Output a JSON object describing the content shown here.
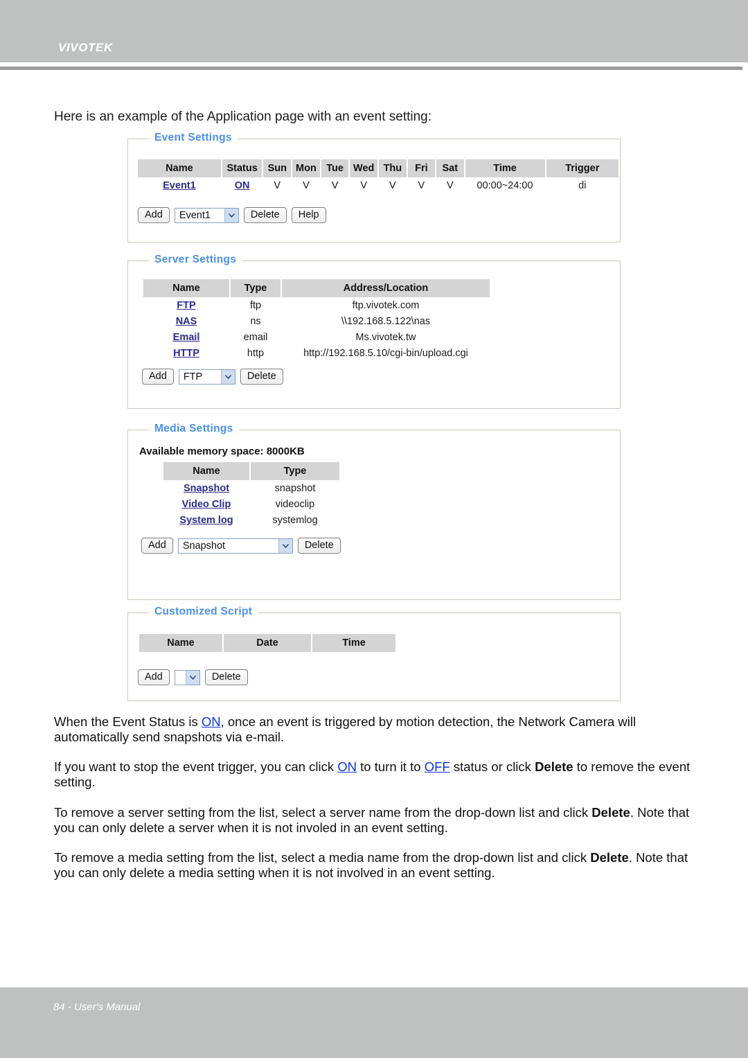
{
  "header": {
    "brand": "VIVOTEK"
  },
  "footer": {
    "text": "84 - User's Manual"
  },
  "intro": "Here is an example of the Application page with an event setting:",
  "event_settings": {
    "legend": "Event Settings",
    "columns": [
      "Name",
      "Status",
      "Sun",
      "Mon",
      "Tue",
      "Wed",
      "Thu",
      "Fri",
      "Sat",
      "Time",
      "Trigger"
    ],
    "rows": [
      {
        "name": "Event1",
        "status": "ON",
        "sun": "V",
        "mon": "V",
        "tue": "V",
        "wed": "V",
        "thu": "V",
        "fri": "V",
        "sat": "V",
        "time": "00:00~24:00",
        "trigger": "di"
      }
    ],
    "controls": {
      "add_label": "Add",
      "select_value": "Event1",
      "delete_label": "Delete",
      "help_label": "Help"
    }
  },
  "server_settings": {
    "legend": "Server Settings",
    "columns": [
      "Name",
      "Type",
      "Address/Location"
    ],
    "rows": [
      {
        "name": "FTP",
        "type": "ftp",
        "address": "ftp.vivotek.com"
      },
      {
        "name": "NAS",
        "type": "ns",
        "address": "\\\\192.168.5.122\\nas"
      },
      {
        "name": "Email",
        "type": "email",
        "address": "Ms.vivotek.tw"
      },
      {
        "name": "HTTP",
        "type": "http",
        "address": "http://192.168.5.10/cgi-bin/upload.cgi"
      }
    ],
    "controls": {
      "add_label": "Add",
      "select_value": "FTP",
      "delete_label": "Delete"
    }
  },
  "media_settings": {
    "legend": "Media Settings",
    "memory_line": "Available memory space: 8000KB",
    "columns": [
      "Name",
      "Type"
    ],
    "rows": [
      {
        "name": "Snapshot",
        "type": "snapshot"
      },
      {
        "name": "Video Clip",
        "type": "videoclip"
      },
      {
        "name": "System log",
        "type": "systemlog"
      }
    ],
    "controls": {
      "add_label": "Add",
      "select_value": "Snapshot",
      "delete_label": "Delete"
    }
  },
  "customized_script": {
    "legend": "Customized Script",
    "columns": [
      "Name",
      "Date",
      "Time"
    ],
    "rows": [],
    "controls": {
      "add_label": "Add",
      "select_value": "",
      "delete_label": "Delete"
    }
  },
  "paragraphs": {
    "p1_a": "When the Event Status is ",
    "p1_on": "ON",
    "p1_b": ", once an event is triggered by motion detection, the Network Camera will automatically send snapshots via e-mail.",
    "p2_a": "If you want to stop the event trigger, you can click ",
    "p2_on": "ON",
    "p2_b": " to turn it to ",
    "p2_off": "OFF",
    "p2_c": " status or click ",
    "p2_delete": "Delete",
    "p2_d": " to remove the event setting.",
    "p3_a": "To remove a server setting from the list, select a server name from the drop-down list and click ",
    "p3_delete": "Delete",
    "p3_b": ". Note that you can only delete a server when it is not involed in an event setting.",
    "p4_a": "To remove a media setting from the list, select a media name from the drop-down list and click ",
    "p4_delete": "Delete",
    "p4_b": ". Note that you can only delete a media setting when it is not involved in an event setting."
  },
  "colors": {
    "legend_blue": "#4a90e8",
    "link_blue": "#0a34d6",
    "table_header_gray": "#d4d4d4",
    "band_gray": "#bfc1c1"
  }
}
